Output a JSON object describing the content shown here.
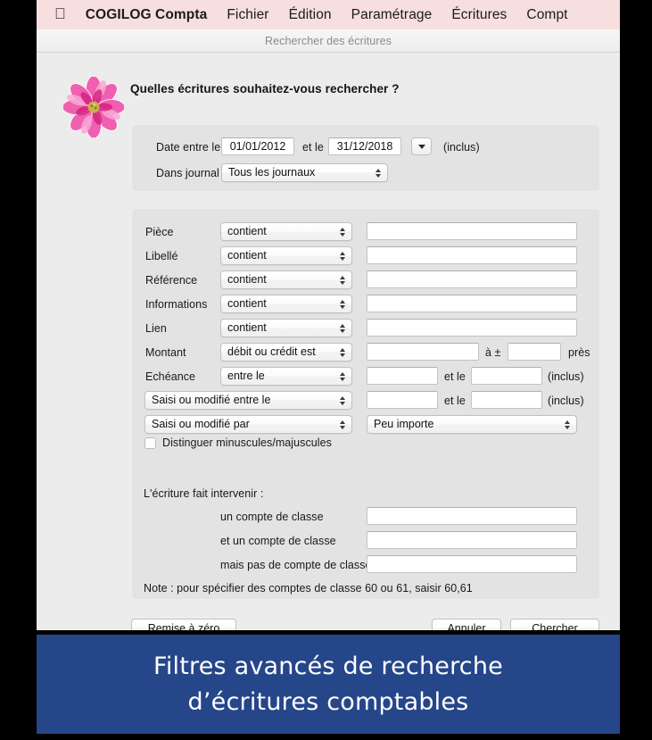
{
  "menubar": {
    "apple_icon": "apple-logo-icon",
    "items": [
      {
        "label": "COGILOG Compta",
        "bold": true
      },
      {
        "label": "Fichier",
        "bold": false
      },
      {
        "label": "Édition",
        "bold": false
      },
      {
        "label": "Paramétrage",
        "bold": false
      },
      {
        "label": "Écritures",
        "bold": false
      },
      {
        "label": "Compt",
        "bold": false
      }
    ]
  },
  "window": {
    "title": "Rechercher des écritures",
    "icon": "pink-flower-icon",
    "headline": "Quelles écritures souhaitez-vous rechercher ?"
  },
  "dates": {
    "label_date": "Date entre le",
    "from_value": "01/01/2012",
    "between_label": "et le",
    "to_value": "31/12/2018",
    "picker_icon": "chevron-down-icon",
    "inclus": "(inclus)",
    "label_journal": "Dans journal",
    "journal_value": "Tous les journaux"
  },
  "criteria": {
    "rows": [
      {
        "label": "Pièce",
        "operator": "contient",
        "value": ""
      },
      {
        "label": "Libellé",
        "operator": "contient",
        "value": ""
      },
      {
        "label": "Référence",
        "operator": "contient",
        "value": ""
      },
      {
        "label": "Informations",
        "operator": "contient",
        "value": ""
      },
      {
        "label": "Lien",
        "operator": "contient",
        "value": ""
      }
    ],
    "montant": {
      "label": "Montant",
      "operator": "débit ou crédit est",
      "value": "",
      "tolerance_prefix": "à ±",
      "tolerance_value": "",
      "tolerance_suffix": "près"
    },
    "echeance": {
      "label": "Echéance",
      "operator": "entre le",
      "from_value": "",
      "mid_label": "et le",
      "to_value": "",
      "suffix": "(inclus)"
    },
    "saisi_entre": {
      "operator": "Saisi ou modifié entre le",
      "from_value": "",
      "mid_label": "et le",
      "to_value": "",
      "suffix": "(inclus)"
    },
    "saisi_par": {
      "operator": "Saisi ou modifié par",
      "value": "Peu importe"
    },
    "case_sensitive": {
      "label": "Distinguer minuscules/majuscules",
      "checked": false
    }
  },
  "accounts": {
    "heading": "L'écriture fait intervenir :",
    "rows": [
      {
        "label": "un compte de classe",
        "value": ""
      },
      {
        "label": "et un compte de classe",
        "value": ""
      },
      {
        "label": "mais pas de compte de classe",
        "value": ""
      }
    ],
    "note": "Note : pour spécifier des comptes de classe 60 ou 61, saisir 60,61"
  },
  "buttons": {
    "reset": "Remise à zéro",
    "cancel": "Annuler",
    "search": "Chercher"
  },
  "caption": {
    "line1": "Filtres avancés de recherche",
    "line2": "d’écritures comptables",
    "background": "#26468a"
  }
}
